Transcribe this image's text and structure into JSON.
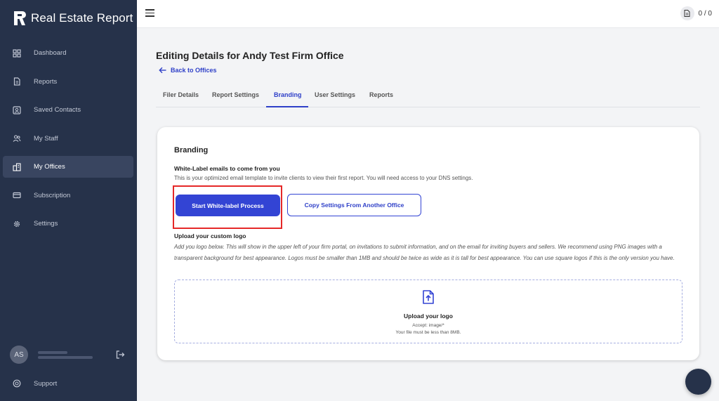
{
  "app": {
    "title": "Real Estate Report"
  },
  "sidebar": {
    "items": [
      {
        "label": "Dashboard",
        "icon": "dashboard-icon"
      },
      {
        "label": "Reports",
        "icon": "document-icon"
      },
      {
        "label": "Saved Contacts",
        "icon": "contacts-icon"
      },
      {
        "label": "My Staff",
        "icon": "staff-icon"
      },
      {
        "label": "My Offices",
        "icon": "offices-icon",
        "active": true
      },
      {
        "label": "Subscription",
        "icon": "credit-card-icon"
      },
      {
        "label": "Settings",
        "icon": "gear-icon"
      }
    ],
    "user": {
      "initials": "AS"
    },
    "support_label": "Support"
  },
  "topbar": {
    "counter": "0 / 0"
  },
  "page": {
    "title": "Editing Details for Andy Test Firm Office",
    "back_label": "Back to Offices",
    "tabs": [
      "Filer Details",
      "Report Settings",
      "Branding",
      "User Settings",
      "Reports"
    ],
    "active_tab": "Branding"
  },
  "branding": {
    "title": "Branding",
    "whitelabel_heading": "White-Label emails to come from you",
    "whitelabel_desc": "This is your optimized email template to invite clients to view their first report. You will need access to your DNS settings.",
    "start_button": "Start White-label Process",
    "copy_button": "Copy Settings From Another Office",
    "logo_heading": "Upload your custom logo",
    "logo_desc": "Add you logo below. This will show in the upper left of your firm portal, on invitations to submit information, and on the email for inviting buyers and sellers. We recommend using PNG images with a transparent background for best appearance. Logos must be smaller than 1MB and should be twice as wide as it is tall for best appearance. You can use square logos if this is the only version you have.",
    "upload_title": "Upload your logo",
    "upload_accept": "Accept: image/*",
    "upload_size": "Your file must be less than 8MB."
  },
  "colors": {
    "sidebar": "#26324a",
    "accent": "#3344d4",
    "highlight": "#e52828"
  }
}
